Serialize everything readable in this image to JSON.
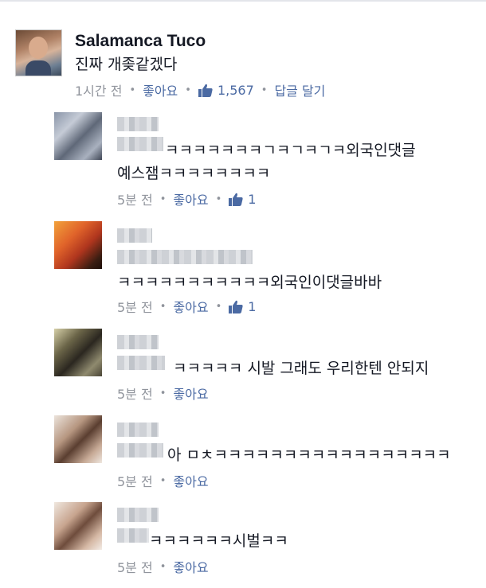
{
  "main_comment": {
    "author": "Salamanca Tuco",
    "text": "진짜 개좆같겠다",
    "time": "1시간 전",
    "like_label": "좋아요",
    "like_count": "1,567",
    "reply_label": "답글 달기",
    "separator": "•"
  },
  "replies": [
    {
      "text_line1": "ㅋㅋㅋㅋㅋㅋㅋㄱㅋㄱㅋㄱㅋ외국인댓글",
      "text_line2": "예스잼ㅋㅋㅋㅋㅋㅋㅋㅋ",
      "time": "5분 전",
      "like_label": "좋아요",
      "like_count": "1"
    },
    {
      "text_line1": "ㅋㅋㅋㅋㅋㅋㅋㅋㅋㅋㅋ외국인이댓글바바",
      "time": "5분 전",
      "like_label": "좋아요",
      "like_count": "1"
    },
    {
      "text_line1": "ㅋㅋㅋㅋㅋ 시발 그래도 우리한텐 안되지",
      "time": "5분 전",
      "like_label": "좋아요"
    },
    {
      "text_line1": "아 ㅁㅊㅋㅋㅋㅋㅋㅋㅋㅋㅋㅋㅋㅋㅋㅋㅋㅋㅋ",
      "time": "5분 전",
      "like_label": "좋아요"
    },
    {
      "text_line1": "ㅋㅋㅋㅋㅋㅋ시벌ㅋㅋ",
      "time": "5분 전",
      "like_label": "좋아요"
    }
  ],
  "colors": {
    "link": "#4b6aa3",
    "meta": "#90949c",
    "text": "#141823"
  },
  "icons": {
    "like": "thumbs-up-icon"
  }
}
